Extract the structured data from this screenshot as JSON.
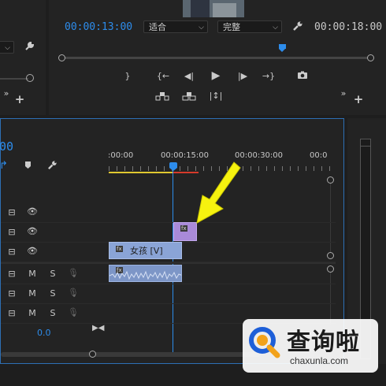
{
  "program_monitor": {
    "timecode_current": "00:00:13:00",
    "fit_select": "适合",
    "quality_select": "完整",
    "timecode_duration": "00:00:18:00"
  },
  "sequence": {
    "timecode_partial": "00",
    "ruler_labels": [
      ":00:00",
      "00:00:15:00",
      "00:00:30:00",
      "00:0"
    ],
    "audio_volume": "0.0"
  },
  "clip": {
    "video_label": "女孩 [V]",
    "fx_badge": "fx"
  },
  "track_controls": {
    "mute": "M",
    "solo": "S"
  },
  "watermark": {
    "brand": "查询啦",
    "url": "chaxunla.com"
  },
  "colors": {
    "accent_blue": "#2d8ceb",
    "clip_video": "#8aa4d6",
    "clip_nested": "#a98ad8",
    "arrow_yellow": "#f6f20f",
    "workarea_yellow": "#e0c830",
    "render_red": "#d63a2a"
  }
}
